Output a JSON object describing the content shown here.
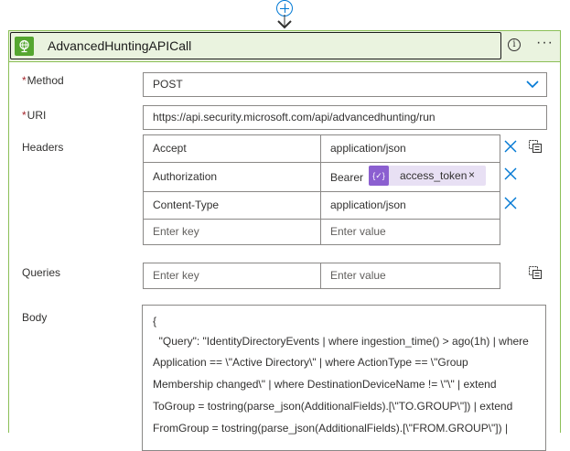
{
  "flow": {
    "add_step_label": "Insert a new step"
  },
  "action": {
    "title": "AdvancedHuntingAPICall",
    "more_label": "···"
  },
  "method": {
    "label": "Method",
    "value": "POST"
  },
  "uri": {
    "label": "URI",
    "value": "https://api.security.microsoft.com/api/advancedhunting/run"
  },
  "headers": {
    "label": "Headers",
    "rows": [
      {
        "key": "Accept",
        "value": "application/json"
      },
      {
        "key": "Authorization",
        "value": "Bearer"
      },
      {
        "key": "Content-Type",
        "value": "application/json"
      }
    ],
    "token": {
      "icon_text": "{✓}",
      "label": "access_token",
      "close": "×"
    },
    "key_placeholder": "Enter key",
    "value_placeholder": "Enter value"
  },
  "queries": {
    "label": "Queries",
    "key_placeholder": "Enter key",
    "value_placeholder": "Enter value"
  },
  "body": {
    "label": "Body",
    "lines": [
      "{",
      "  \"Query\": \"IdentityDirectoryEvents | where ingestion_time() > ago(1h) | where",
      "Application == \\\"Active Directory\\\" | where ActionType == \\\"Group",
      "Membership changed\\\" | where DestinationDeviceName != \\\"\\\" | extend",
      "ToGroup = tostring(parse_json(AdditionalFields).[\\\"TO.GROUP\\\"]) | extend",
      "FromGroup = tostring(parse_json(AdditionalFields).[\\\"FROM.GROUP\\\"]) |"
    ]
  },
  "colors": {
    "accent": "#0078d4",
    "card_border": "#8bbf57",
    "header_bg": "#eaf3df",
    "connector": "#55a630",
    "token_bg": "#e8e0f4",
    "token_icon": "#8b5fd0"
  }
}
